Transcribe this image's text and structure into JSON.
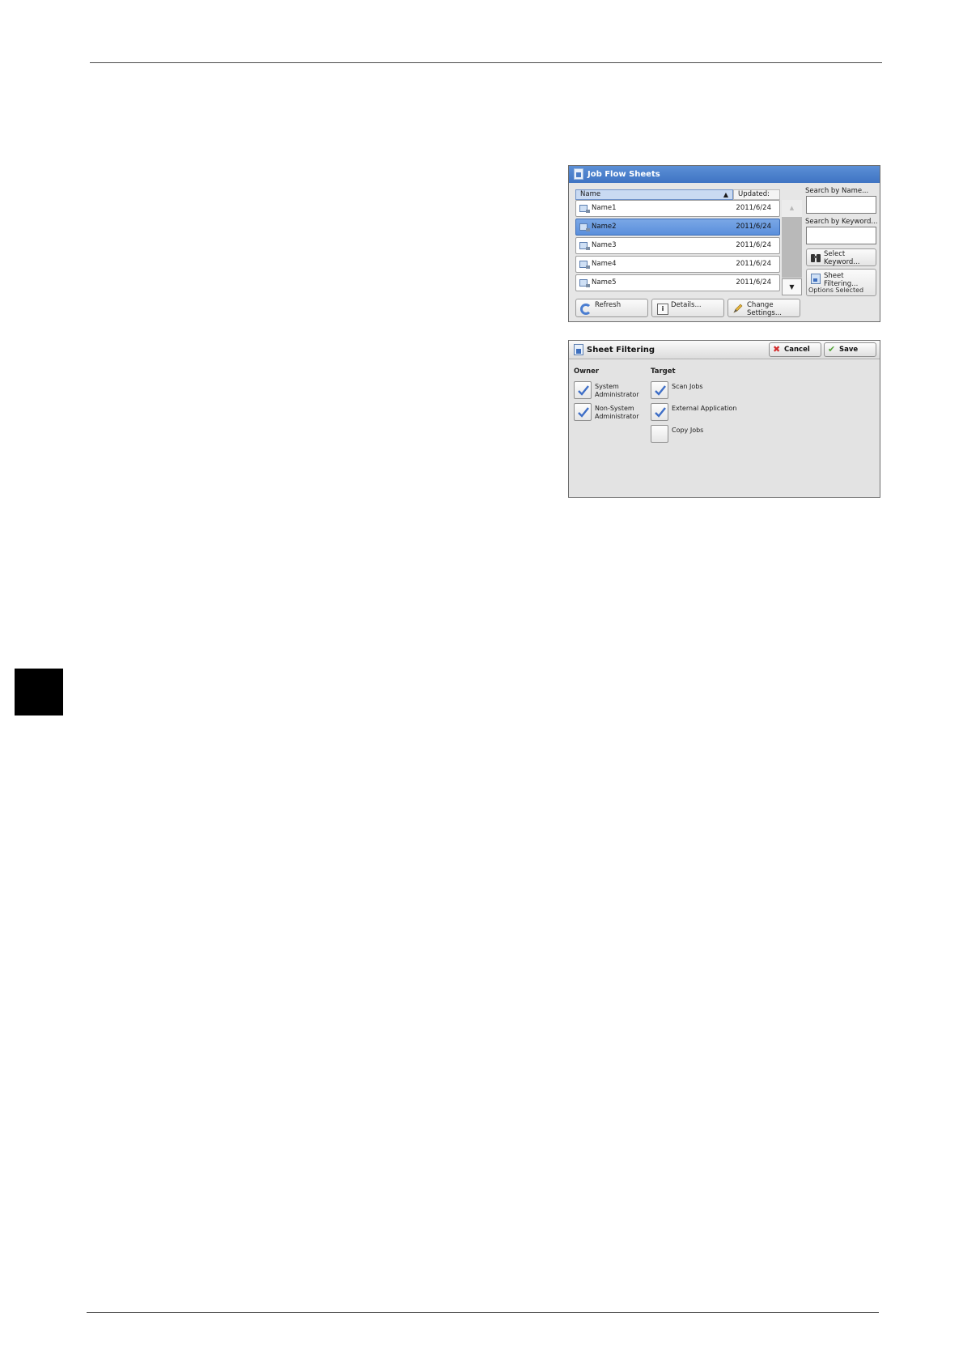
{
  "job_flow_sheets": {
    "title": "Job Flow Sheets",
    "columns": {
      "name": "Name",
      "updated": "Updated:"
    },
    "rows": [
      {
        "name": "Name1",
        "date": "2011/6/24",
        "selected": false
      },
      {
        "name": "Name2",
        "date": "2011/6/24",
        "selected": true
      },
      {
        "name": "Name3",
        "date": "2011/6/24",
        "selected": false
      },
      {
        "name": "Name4",
        "date": "2011/6/24",
        "selected": false
      },
      {
        "name": "Name5",
        "date": "2011/6/24",
        "selected": false
      }
    ],
    "search_by_name_label": "Search by Name...",
    "search_by_keyword_label": "Search by Keyword...",
    "select_keyword_label": "Select\nKeyword...",
    "sheet_filtering_label": "Sheet Filtering...",
    "sheet_filtering_status": "Options Selected",
    "refresh_label": "Refresh",
    "details_label": "Details...",
    "change_settings_label": "Change\nSettings..."
  },
  "sheet_filtering": {
    "title": "Sheet Filtering",
    "cancel_label": "Cancel",
    "save_label": "Save",
    "owner": {
      "label": "Owner",
      "options": [
        {
          "label": "System\nAdministrator",
          "checked": true
        },
        {
          "label": "Non-System\nAdministrator",
          "checked": true
        }
      ]
    },
    "target": {
      "label": "Target",
      "options": [
        {
          "label": "Scan Jobs",
          "checked": true
        },
        {
          "label": "External Application",
          "checked": true
        },
        {
          "label": "Copy Jobs",
          "checked": false
        }
      ]
    }
  },
  "colors": {
    "title_blue": "#3f74c3",
    "selected_row": "#5a8fdc",
    "check_blue": "#3f6fc7"
  }
}
